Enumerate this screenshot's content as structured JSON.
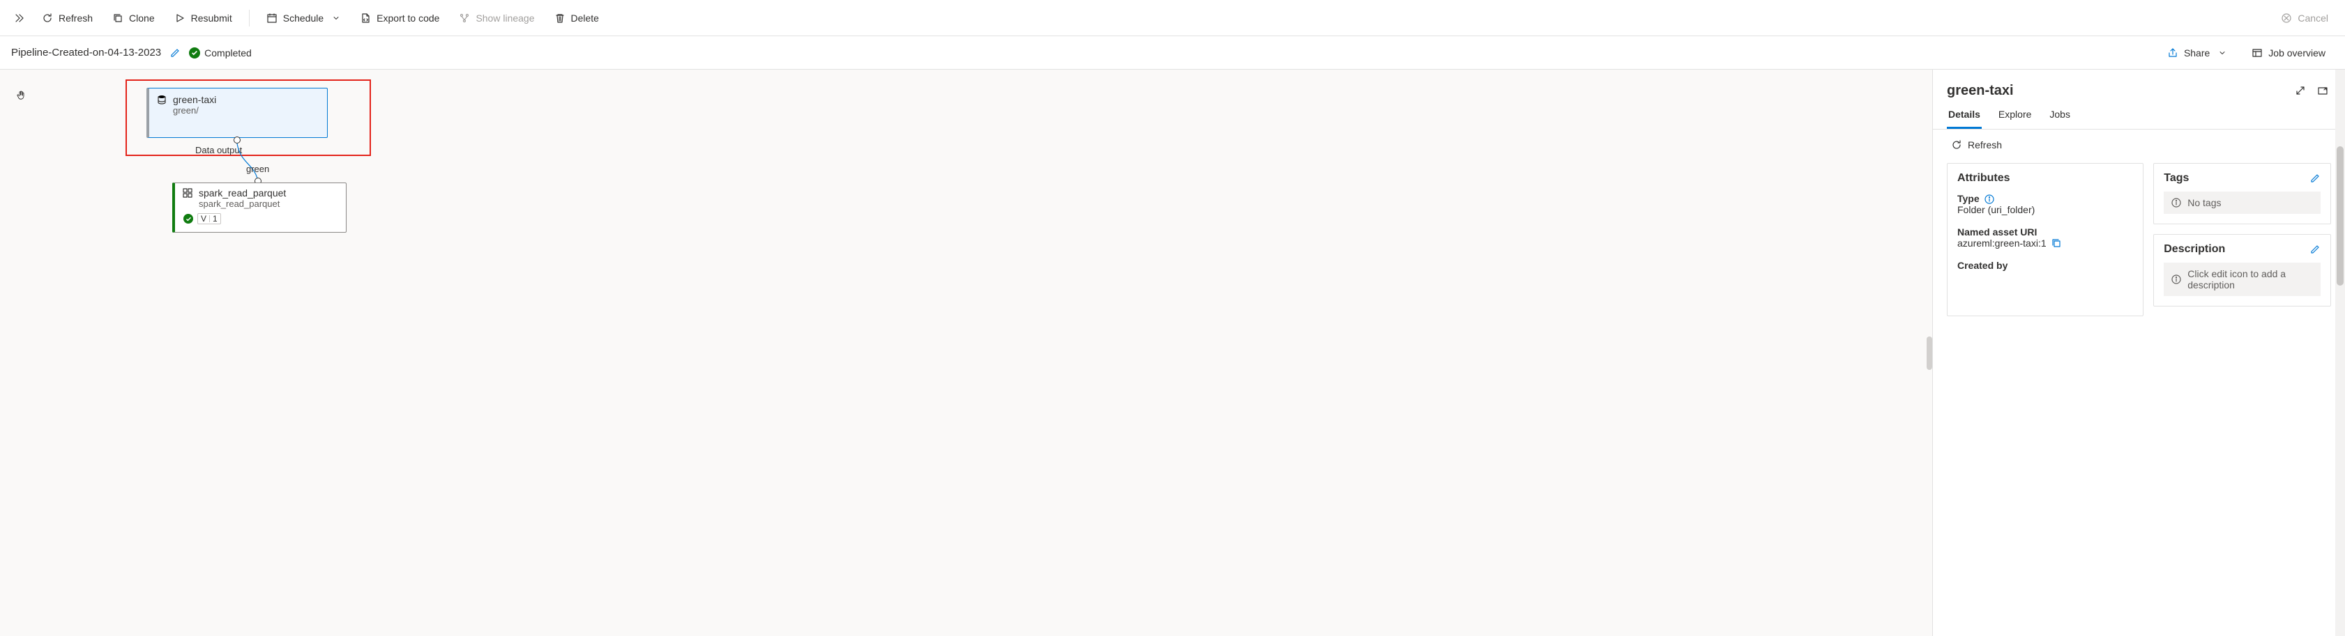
{
  "toolbar": {
    "refresh": "Refresh",
    "clone": "Clone",
    "resubmit": "Resubmit",
    "schedule": "Schedule",
    "export": "Export to code",
    "lineage": "Show lineage",
    "delete": "Delete",
    "cancel": "Cancel"
  },
  "nameBar": {
    "pipelineName": "Pipeline-Created-on-04-13-2023",
    "status": "Completed",
    "share": "Share",
    "jobOverview": "Job overview"
  },
  "canvas": {
    "nodeGreen": {
      "title": "green-taxi",
      "subtitle": "green/",
      "outputLabel": "Data output"
    },
    "edgeLabel": "green",
    "nodeSpark": {
      "title": "spark_read_parquet",
      "subtitle": "spark_read_parquet",
      "metaV": "V",
      "meta1": "1"
    }
  },
  "panel": {
    "title": "green-taxi",
    "tabs": {
      "details": "Details",
      "explore": "Explore",
      "jobs": "Jobs"
    },
    "refresh": "Refresh",
    "attributes": {
      "heading": "Attributes",
      "typeLabel": "Type",
      "typeValue": "Folder (uri_folder)",
      "uriLabel": "Named asset URI",
      "uriValue": "azureml:green-taxi:1",
      "createdByLabel": "Created by"
    },
    "tags": {
      "heading": "Tags",
      "emptyText": "No tags"
    },
    "description": {
      "heading": "Description",
      "placeholder": "Click edit icon to add a description"
    }
  }
}
